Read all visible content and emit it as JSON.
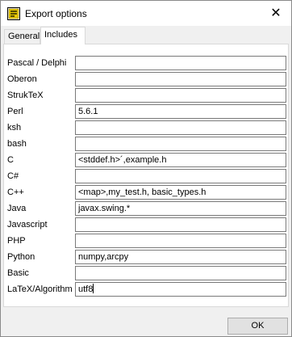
{
  "window": {
    "title": "Export options",
    "app_icon": "app-icon",
    "close_icon": "close-icon"
  },
  "tabs": [
    {
      "label": "General",
      "active": false
    },
    {
      "label": "Includes",
      "active": true
    }
  ],
  "includes": [
    {
      "label": "Pascal / Delphi",
      "value": ""
    },
    {
      "label": "Oberon",
      "value": ""
    },
    {
      "label": "StrukTeX",
      "value": ""
    },
    {
      "label": "Perl",
      "value": "5.6.1"
    },
    {
      "label": "ksh",
      "value": ""
    },
    {
      "label": "bash",
      "value": ""
    },
    {
      "label": "C",
      "value": "<stddef.h>´,example.h"
    },
    {
      "label": "C#",
      "value": ""
    },
    {
      "label": "C++",
      "value": "<map>,my_test.h, basic_types.h"
    },
    {
      "label": "Java",
      "value": "javax.swing.*"
    },
    {
      "label": "Javascript",
      "value": ""
    },
    {
      "label": "PHP",
      "value": ""
    },
    {
      "label": "Python",
      "value": "numpy,arcpy"
    },
    {
      "label": "Basic",
      "value": ""
    },
    {
      "label": "LaTeX/Algorithm",
      "value": "utf8"
    }
  ],
  "footer": {
    "ok_label": "OK"
  }
}
